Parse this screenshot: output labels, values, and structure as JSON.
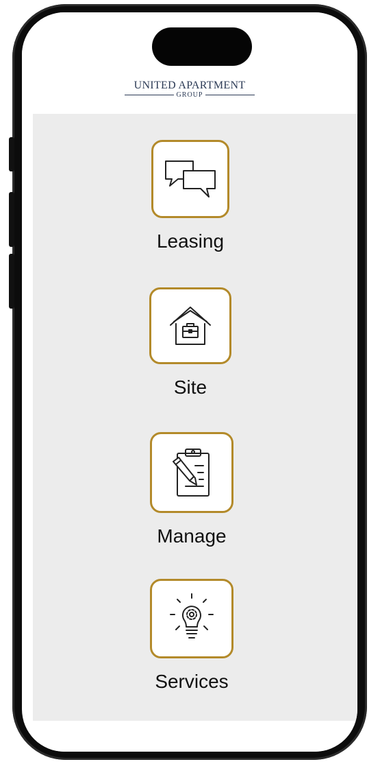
{
  "brand": {
    "name_line": "UNITED APARTMENT",
    "sub_line": "GROUP"
  },
  "menu": {
    "items": [
      {
        "label": "Leasing",
        "icon": "chat-bubbles-icon"
      },
      {
        "label": "Site",
        "icon": "house-briefcase-icon"
      },
      {
        "label": "Manage",
        "icon": "clipboard-pen-icon"
      },
      {
        "label": "Services",
        "icon": "lightbulb-gear-icon"
      }
    ]
  },
  "colors": {
    "accent": "#b38a2a",
    "content_bg": "#ececec",
    "brand_text": "#2b3a55"
  }
}
